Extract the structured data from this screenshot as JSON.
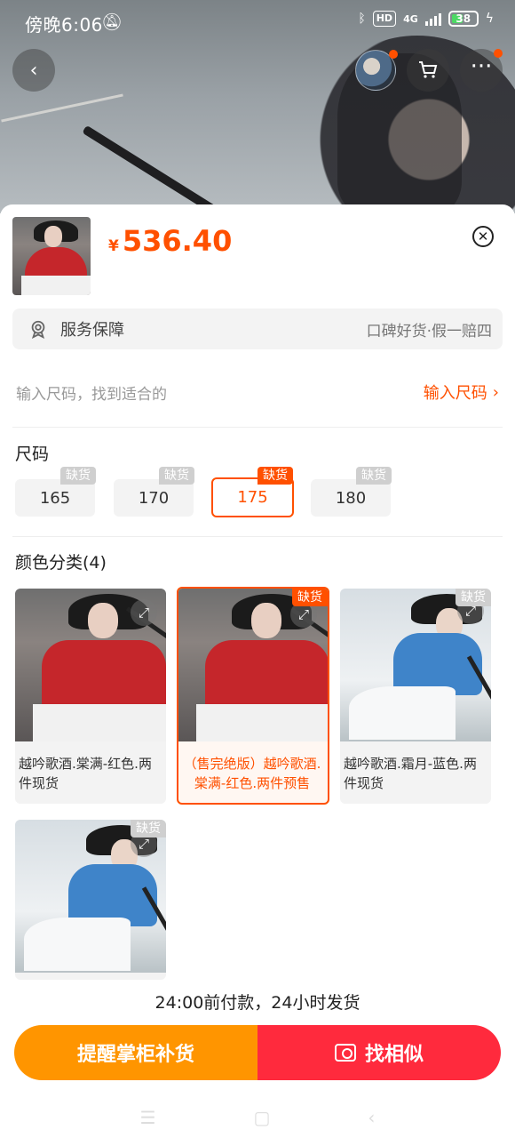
{
  "status_bar": {
    "time": "傍晚6:06",
    "network": "4G",
    "hd": "HD",
    "battery": "38"
  },
  "top_nav": {
    "back_icon": "back-arrow-icon",
    "cart_icon": "cart-icon",
    "more_icon": "more-dots-icon"
  },
  "product": {
    "currency": "¥",
    "price": "536.40"
  },
  "service": {
    "label": "服务保障",
    "detail": "口碑好货·假一赔四"
  },
  "size_finder": {
    "hint": "输入尺码，找到适合的",
    "link": "输入尺码"
  },
  "size_section": {
    "title": "尺码",
    "options": [
      {
        "label": "165",
        "badge": "缺货",
        "selected": false
      },
      {
        "label": "170",
        "badge": "缺货",
        "selected": false
      },
      {
        "label": "175",
        "badge": "缺货",
        "selected": true
      },
      {
        "label": "180",
        "badge": "缺货",
        "selected": false
      }
    ]
  },
  "color_section": {
    "title": "颜色分类(4)",
    "options": [
      {
        "caption": "越吟歌酒.棠满-红色.两件现货",
        "badge": "",
        "selected": false
      },
      {
        "caption": "（售完绝版）越吟歌酒.棠满-红色.两件预售",
        "badge": "缺货",
        "selected": true
      },
      {
        "caption": "越吟歌酒.霜月-蓝色.两件现货",
        "badge": "缺货",
        "selected": false
      },
      {
        "caption": "",
        "badge": "缺货",
        "selected": false
      }
    ]
  },
  "shipping_note": "24:00前付款，24小时发货",
  "actions": {
    "remind": "提醒掌柜补货",
    "similar": "找相似"
  },
  "colors": {
    "accent": "#ff5000",
    "remind_button": "#ff9500",
    "similar_button": "#ff2a3d"
  }
}
